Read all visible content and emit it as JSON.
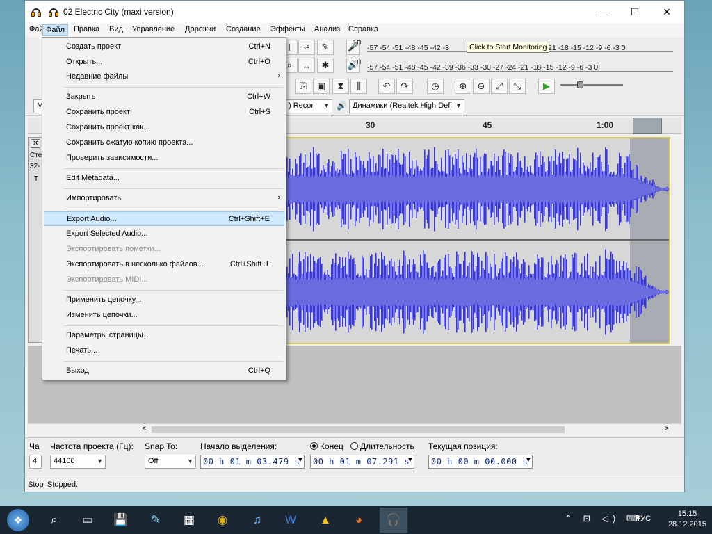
{
  "window": {
    "title": "02 Electric City (maxi version)",
    "controls": {
      "minimize": "—",
      "maximize": "☐",
      "close": "✕"
    }
  },
  "menubar": {
    "items": [
      "Файл",
      "Правка",
      "Вид",
      "Управление",
      "Дорожки",
      "Создание",
      "Эффекты",
      "Анализ",
      "Справка"
    ],
    "behind_label": "Фай"
  },
  "meters": {
    "record": {
      "ch": "Л\nП",
      "scale": "-57 -54 -51 -48 -45 -42 -3",
      "tail": "21 -18 -15 -12 -9 -6 -3 0"
    },
    "playback": {
      "ch": "Л\nП",
      "scale": "-57 -54 -51 -48 -45 -42 -39 -36 -33 -30 -27 -24 -21 -18 -15 -12 -9 -6 -3 0"
    }
  },
  "tooltip": "Click to Start Monitoring",
  "devices": {
    "host": "M",
    "record_device": ") Recor",
    "playback_device": "Динамики (Realtek High Defi"
  },
  "timeline": {
    "ticks": [
      "30",
      "45",
      "1:00"
    ]
  },
  "track_panel": {
    "close": "✕",
    "line1": "Сте",
    "line2": "32-",
    "line3": "T"
  },
  "file_menu": {
    "items": [
      {
        "label": "Создать проект",
        "shortcut": "Ctrl+N"
      },
      {
        "label": "Открыть...",
        "shortcut": "Ctrl+O"
      },
      {
        "label": "Недавние файлы",
        "shortcut": "",
        "submenu": "›"
      },
      {
        "label": "Закрыть",
        "shortcut": "Ctrl+W"
      },
      {
        "label": "Сохранить проект",
        "shortcut": "Ctrl+S"
      },
      {
        "label": "Сохранить проект как...",
        "shortcut": ""
      },
      {
        "label": "Сохранить сжатую копию проекта...",
        "shortcut": ""
      },
      {
        "label": "Проверить зависимости...",
        "shortcut": ""
      },
      {
        "label": "Edit Metadata...",
        "shortcut": ""
      },
      {
        "label": "Импортировать",
        "shortcut": "",
        "submenu": "›"
      },
      {
        "label": "Export Audio...",
        "shortcut": "Ctrl+Shift+E"
      },
      {
        "label": "Export Selected Audio...",
        "shortcut": ""
      },
      {
        "label": "Экспортировать пометки...",
        "shortcut": ""
      },
      {
        "label": "Экспортировать в несколько файлов...",
        "shortcut": "Ctrl+Shift+L"
      },
      {
        "label": "Экспортировать MIDI...",
        "shortcut": ""
      },
      {
        "label": "Применить цепочку...",
        "shortcut": ""
      },
      {
        "label": "Изменить цепочки...",
        "shortcut": ""
      },
      {
        "label": "Параметры страницы...",
        "shortcut": ""
      },
      {
        "label": "Печать...",
        "shortcut": ""
      },
      {
        "label": "Выход",
        "shortcut": "Ctrl+Q"
      }
    ]
  },
  "selection_bar": {
    "rate_label": "Частота проекта (Гц):",
    "rate_value": "44100",
    "snap_label": "Snap To:",
    "snap_value": "Off",
    "start_label": "Начало выделения:",
    "start_value": "00 h 01 m 03.479 s",
    "end_label": "Конец",
    "length_label": "Длительность",
    "end_value": "00 h 01 m 07.291 s",
    "pos_label": "Текущая позиция:",
    "pos_value": "00 h 00 m 00.000 s",
    "left_cut_label": "Ча",
    "left_cut_value": "4"
  },
  "status": {
    "left": "Stop",
    "main": "Stopped."
  },
  "taskbar": {
    "lang": "РУС",
    "time": "15:15",
    "date": "28.12.2015",
    "tray_icons": [
      "chevron-up",
      "network",
      "volume",
      "keyboard"
    ]
  }
}
